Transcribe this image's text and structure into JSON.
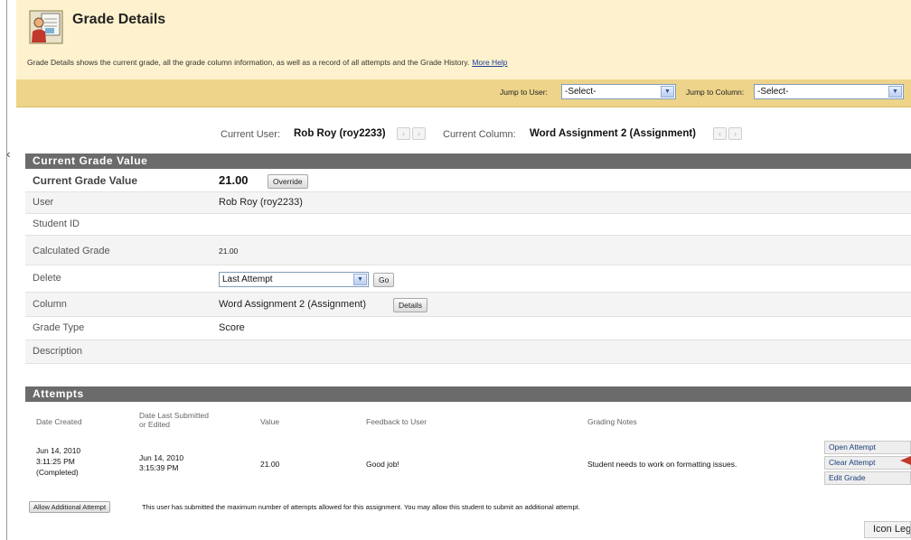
{
  "header": {
    "title": "Grade Details",
    "description": "Grade Details shows the current grade, all the grade column information, as well as a record of all attempts and the Grade History.",
    "help_link": "More Help"
  },
  "jump": {
    "user_label": "Jump to User:",
    "user_value": "-Select-",
    "column_label": "Jump to Column:",
    "column_value": "-Select-"
  },
  "nav": {
    "user_label": "Current User:",
    "user_value": "Rob Roy (roy2233)",
    "column_label": "Current Column:",
    "column_value": "Word Assignment 2 (Assignment)"
  },
  "grade_section": {
    "title": "Current Grade Value",
    "current_label": "Current Grade Value",
    "current_value": "21.00",
    "override_label": "Override",
    "user_label": "User",
    "user_value": "Rob Roy (roy2233)",
    "student_id_label": "Student ID",
    "calc_label": "Calculated Grade",
    "calc_value": "21.00",
    "delete_label": "Delete",
    "delete_value": "Last Attempt",
    "go_label": "Go",
    "column_label": "Column",
    "column_value": "Word Assignment 2 (Assignment)",
    "details_label": "Details",
    "grade_type_label": "Grade Type",
    "grade_type_value": "Score",
    "description_label": "Description"
  },
  "attempts": {
    "title": "Attempts",
    "headers": {
      "date_created": "Date Created",
      "date_last_1": "Date Last Submitted",
      "date_last_2": "or Edited",
      "value": "Value",
      "feedback": "Feedback to User",
      "notes": "Grading Notes"
    },
    "row": {
      "created_date": "Jun 14, 2010",
      "created_time": "3:11:25 PM",
      "created_status": "(Completed)",
      "submitted_date": "Jun 14, 2010",
      "submitted_time": "3:15:39 PM",
      "value": "21.00",
      "feedback": "Good job!",
      "notes": "Student needs to work on formatting issues."
    },
    "actions": {
      "open": "Open Attempt",
      "clear": "Clear Attempt",
      "edit": "Edit Grade"
    },
    "allow_button": "Allow Additional Attempt",
    "allow_message": "This user has submitted the maximum number of attempts allowed for this assignment. You may allow this student to submit an additional attempt."
  },
  "footer": {
    "icon_legend": "Icon Legend"
  },
  "colors": {
    "header_bg": "#fdf2cd",
    "jumpbar_bg": "#edd48a",
    "section_bar": "#6b6b6b",
    "link": "#1c3f9e",
    "pointer": "#c0392b"
  }
}
